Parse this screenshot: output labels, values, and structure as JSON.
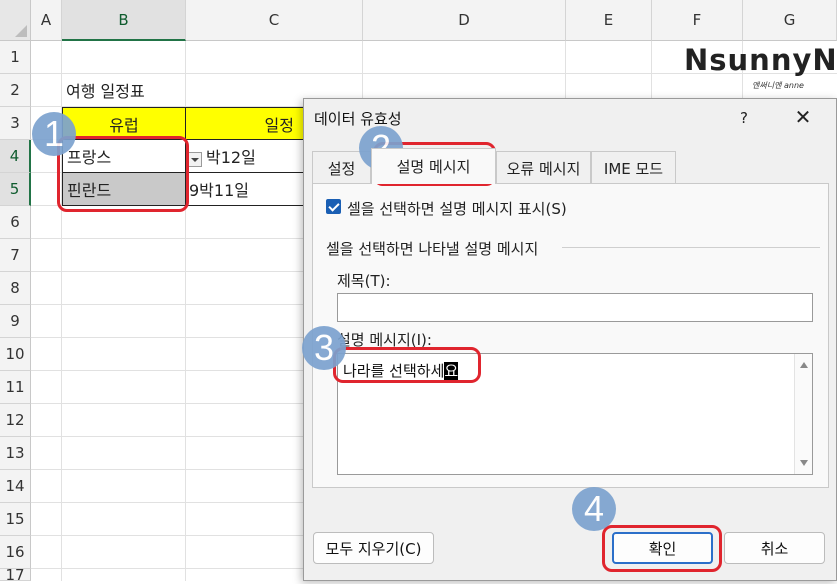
{
  "sheet": {
    "columns": [
      "A",
      "B",
      "C",
      "D",
      "E",
      "F",
      "G"
    ],
    "rows": [
      "1",
      "2",
      "3",
      "4",
      "5",
      "6",
      "7",
      "8",
      "9",
      "10",
      "11",
      "12",
      "13",
      "14",
      "15",
      "16",
      "17"
    ],
    "cells": {
      "b2": "여행 일정표",
      "b3": "유럽",
      "c3": "일정",
      "b4": "프랑스",
      "c4": "박12일",
      "b5": "핀란드",
      "c5": "9박11일"
    },
    "logo": "NsunnyN",
    "logo_sub": "앤써니앤 anne"
  },
  "dialog": {
    "title": "데이터 유효성",
    "help": "?",
    "close": "✕",
    "tabs": [
      "설정",
      "설명 메시지",
      "오류 메시지",
      "IME 모드"
    ],
    "checkbox_label": "셀을 선택하면 설명 메시지 표시(S)",
    "group_label": "셀을 선택하면 나타낼 설명 메시지",
    "title_label": "제목(T):",
    "title_value": "",
    "message_label": "설명 메시지(I):",
    "message_text": "나라를 선택하세",
    "message_cursor_char": "요",
    "clear_all": "모두 지우기(C)",
    "ok": "확인",
    "cancel": "취소"
  },
  "steps": [
    "1",
    "2",
    "3",
    "4"
  ],
  "colors": {
    "accent_green": "#217346",
    "highlight_yellow": "#ffff00",
    "annotation_red": "#e0252e",
    "badge_blue": "#7ca2cf"
  }
}
